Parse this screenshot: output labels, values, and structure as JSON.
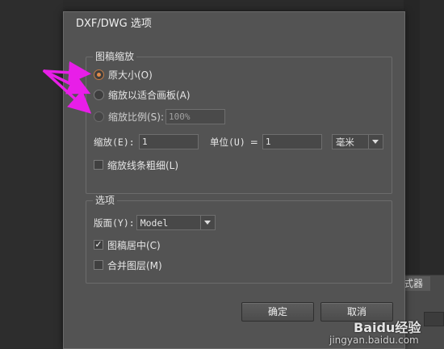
{
  "dialog": {
    "title": "DXF/DWG 选项",
    "scaling": {
      "title": "图稿缩放",
      "option_original": "原大小(O)",
      "option_fit": "缩放以适合画板(A)",
      "option_ratio": "缩放比例(S):",
      "ratio_value": "100%",
      "scale_label": "缩放(E):",
      "scale_value": "1",
      "unit_label": "单位(U)",
      "equals": "=",
      "unit_value": "1",
      "unit_select": "毫米",
      "scale_strokes": "缩放线条粗细(L)"
    },
    "options": {
      "title": "选项",
      "layout_label": "版面(Y):",
      "layout_value": "Model",
      "center_artwork": "图稿居中(C)",
      "merge_layers": "合并图层(M)"
    },
    "ok_label": "确定",
    "cancel_label": "取消"
  },
  "background": {
    "panel_tab": "式器"
  },
  "watermark": {
    "logo": "Baidu经验",
    "url": "jingyan.baidu.com"
  },
  "colors": {
    "dialog_bg": "#535353",
    "arrow": "#e81ee8",
    "radio_selected": "#e08a4a"
  }
}
